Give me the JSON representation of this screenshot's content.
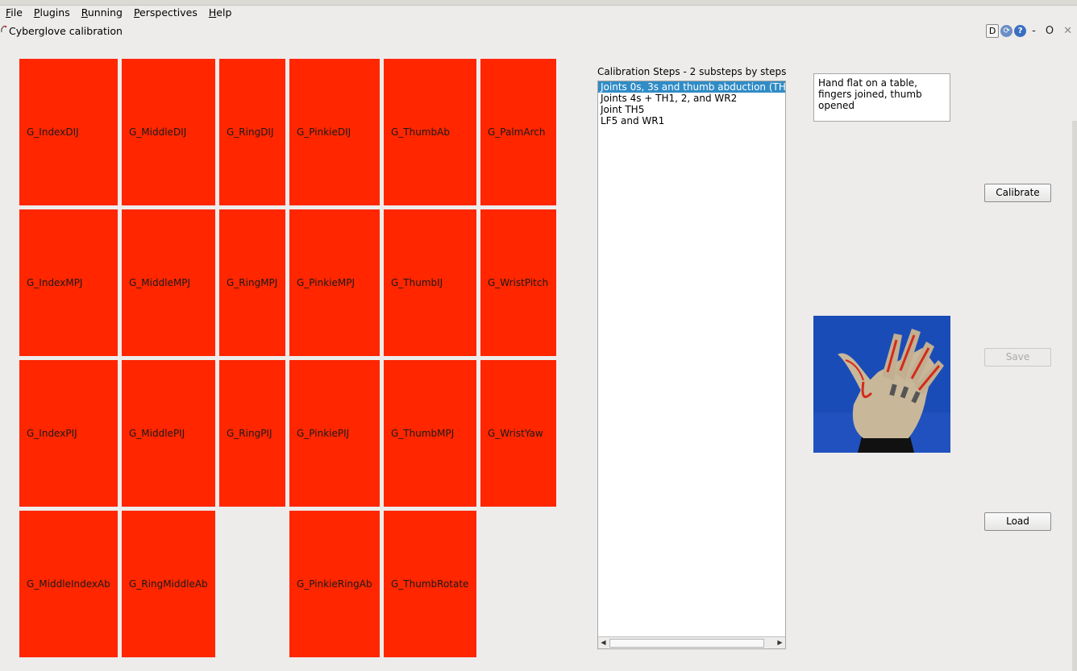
{
  "menu": [
    {
      "mnemonic": "F",
      "rest": "ile"
    },
    {
      "mnemonic": "P",
      "rest": "lugins"
    },
    {
      "mnemonic": "R",
      "rest": "unning"
    },
    {
      "mnemonic": "P",
      "rest": "erspectives"
    },
    {
      "mnemonic": "H",
      "rest": "elp"
    }
  ],
  "window": {
    "title": "Cyberglove calibration",
    "btn_d": "D",
    "btn_help": "?",
    "btn_minimize": "-",
    "btn_float": "O",
    "btn_close": "✕"
  },
  "tile_color": "#ff2600",
  "joints": {
    "r0": [
      "G_IndexDIJ",
      "G_MiddleDIJ",
      "G_RingDIJ",
      "G_PinkieDIJ",
      "G_ThumbAb",
      "G_PalmArch"
    ],
    "r1": [
      "G_IndexMPJ",
      "G_MiddleMPJ",
      "G_RingMPJ",
      "G_PinkieMPJ",
      "G_ThumbIJ",
      "G_WristPitch"
    ],
    "r2": [
      "G_IndexPIJ",
      "G_MiddlePIJ",
      "G_RingPIJ",
      "G_PinkiePIJ",
      "G_ThumbMPJ",
      "G_WristYaw"
    ],
    "r3": [
      "G_MiddleIndexAb",
      "G_RingMiddleAb",
      "G_PinkieRingAb",
      "G_ThumbRotate"
    ]
  },
  "calibration": {
    "title": "Calibration Steps - 2 substeps by steps",
    "steps": [
      "Joints 0s, 3s and thumb abduction (TH",
      "Joints 4s + TH1, 2, and WR2",
      "Joint TH5",
      "LF5 and WR1"
    ],
    "selected_index": 0,
    "instruction": "Hand flat on a table, fingers joined, thumb opened"
  },
  "photo_icon": "glove-photo",
  "buttons": {
    "calibrate": "Calibrate",
    "save": "Save",
    "load": "Load"
  }
}
